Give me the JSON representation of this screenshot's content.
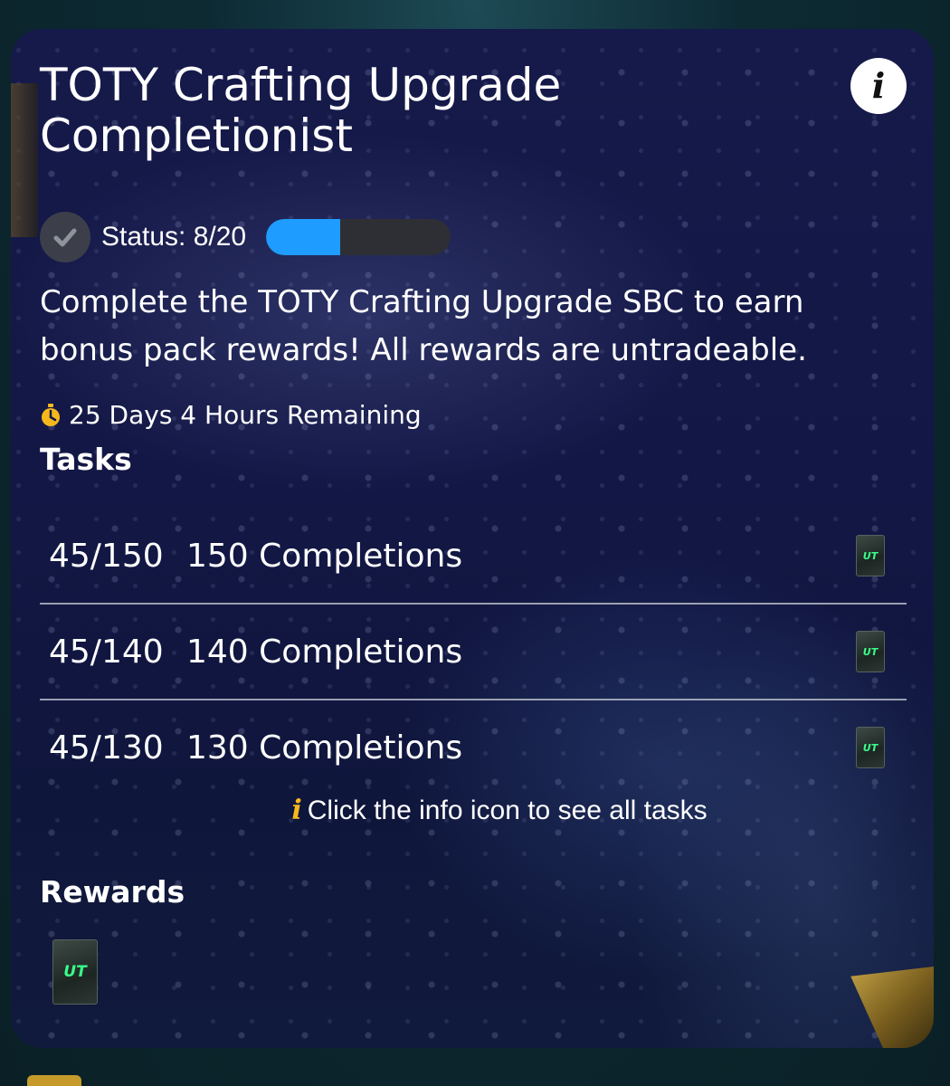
{
  "card": {
    "title": "TOTY Crafting Upgrade Completionist",
    "info_button_glyph": "i",
    "status": {
      "text": "Status: 8/20",
      "completed": 8,
      "total": 20,
      "bar_color": "#1f9cff"
    },
    "description": "Complete the TOTY Crafting Upgrade SBC to earn bonus pack rewards! All rewards are untradeable.",
    "time_remaining": "25 Days 4 Hours Remaining",
    "tasks_heading": "Tasks",
    "tasks": [
      {
        "progress": "45/150",
        "label": "150 Completions",
        "reward_icon": "ut-pack-icon"
      },
      {
        "progress": "45/140",
        "label": "140 Completions",
        "reward_icon": "ut-pack-icon"
      },
      {
        "progress": "45/130",
        "label": "130 Completions",
        "reward_icon": "ut-pack-icon"
      }
    ],
    "info_hint": "Click the info icon to see all tasks",
    "rewards_heading": "Rewards",
    "pack_label": "UT"
  },
  "colors": {
    "accent_blue": "#1f9cff",
    "timer_gold": "#f5b81c",
    "pack_green": "#3aff8a"
  }
}
